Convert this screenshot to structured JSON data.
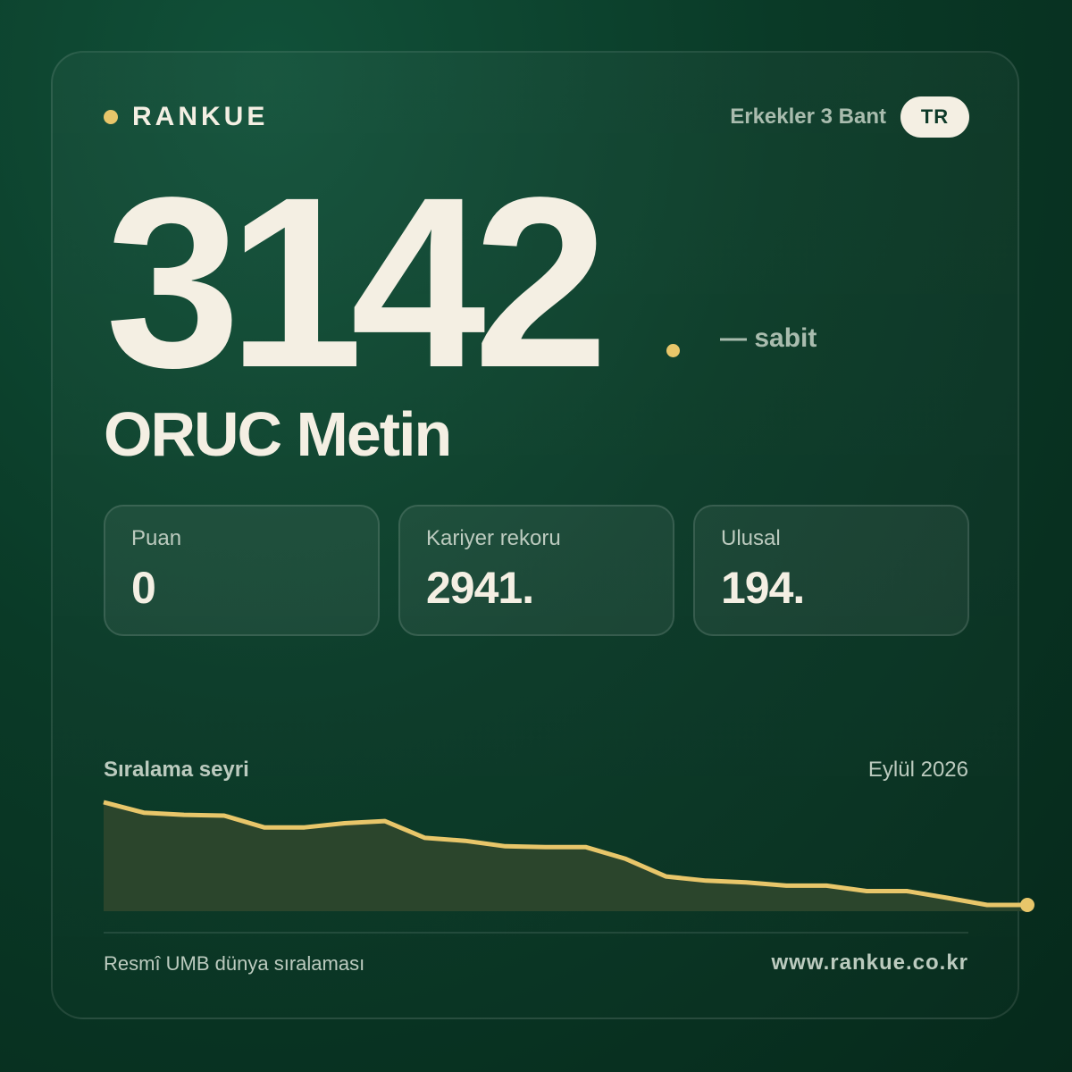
{
  "brand": {
    "name": "RANKUE"
  },
  "header": {
    "category": "Erkekler 3 Bant",
    "country": "TR"
  },
  "rank": {
    "value": "3142",
    "trend": "— sabit"
  },
  "player": {
    "name": "ORUC Metin"
  },
  "stats": [
    {
      "label": "Puan",
      "value": "0"
    },
    {
      "label": "Kariyer rekoru",
      "value": "2941."
    },
    {
      "label": "Ulusal",
      "value": "194."
    }
  ],
  "chart": {
    "title": "Sıralama seyri",
    "date": "Eylül 2026"
  },
  "chart_data": {
    "type": "area",
    "values": [
      2860,
      2885,
      2890,
      2892,
      2920,
      2920,
      2910,
      2905,
      2945,
      2952,
      2965,
      2967,
      2967,
      2995,
      3037,
      3047,
      3051,
      3059,
      3059,
      3072,
      3072,
      3088,
      3105,
      3105
    ],
    "ylim": [
      2860,
      3105
    ],
    "inverted_axis": true,
    "colors": {
      "line": "#e8c66a",
      "fill": "#2b452c"
    }
  },
  "footer": {
    "source": "Resmî UMB dünya sıralaması",
    "url": "www.rankue.co.kr"
  },
  "colors": {
    "accent": "#e8c66a",
    "background": "#0a3a27",
    "text": "#f4efe3",
    "muted": "#a9bcae"
  }
}
